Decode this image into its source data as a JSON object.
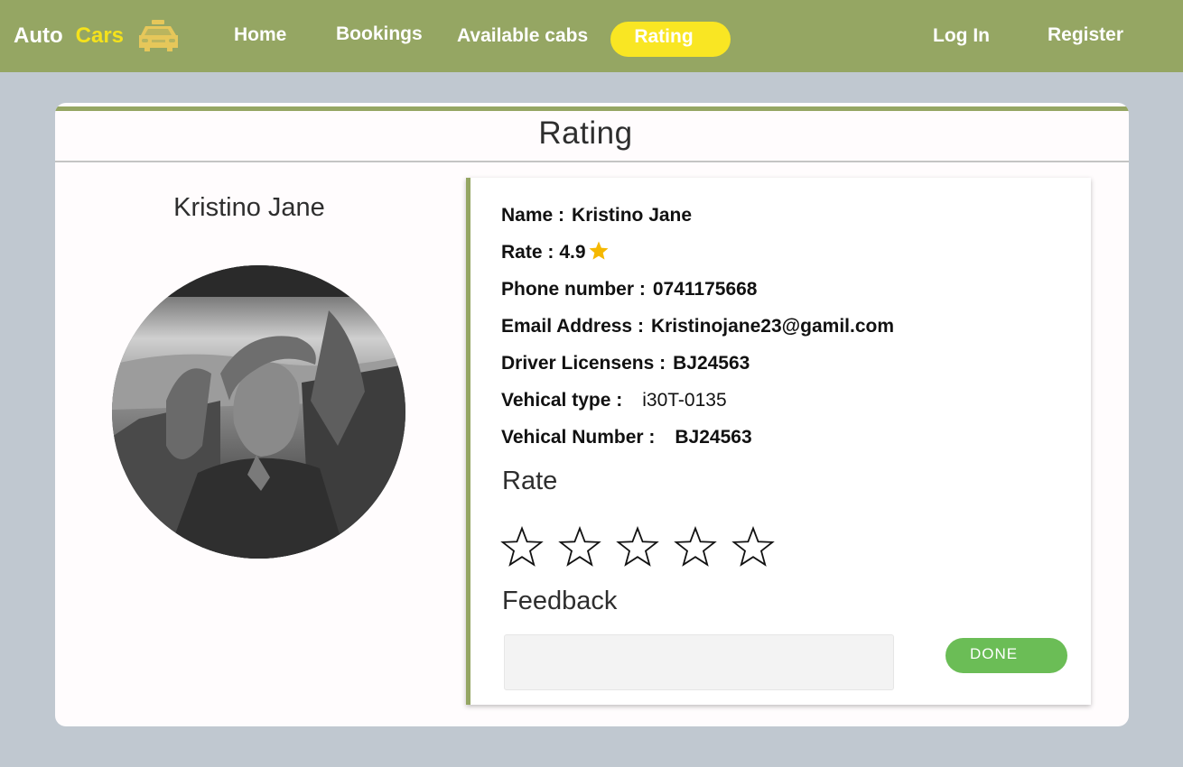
{
  "brand": {
    "part1": "Auto",
    "part2": "Cars",
    "icon": "taxi-icon"
  },
  "nav": {
    "home": "Home",
    "bookings": "Bookings",
    "available_cabs": "Available cabs",
    "rating": "Rating",
    "login": "Log In",
    "register": "Register"
  },
  "card": {
    "title": "Rating"
  },
  "driver": {
    "name": "Kristino Jane",
    "avatar": "driver-photo"
  },
  "details": {
    "name_label": "Name :",
    "name_value": "Kristino Jane",
    "rate_label": "Rate :",
    "rate_value": "4.9",
    "phone_label": "Phone number :",
    "phone_value": "0741175668",
    "email_label": "Email Address :",
    "email_value": "Kristinojane23@gamil.com",
    "license_label": "Driver Licensens :",
    "license_value": "BJ24563",
    "vehicle_type_label": "Vehical type :",
    "vehicle_type_value": "i30T-0135",
    "vehicle_number_label": "Vehical Number :",
    "vehicle_number_value": "BJ24563"
  },
  "rating": {
    "label": "Rate",
    "star_count": 5,
    "selected": 0
  },
  "feedback": {
    "label": "Feedback",
    "value": "",
    "placeholder": ""
  },
  "done_button": "DONE",
  "colors": {
    "navbar": "#95a663",
    "accent_yellow": "#f9e623",
    "page_bg": "#c0c8d0",
    "done_green": "#6bbd56",
    "star_gold": "#f5b800"
  }
}
